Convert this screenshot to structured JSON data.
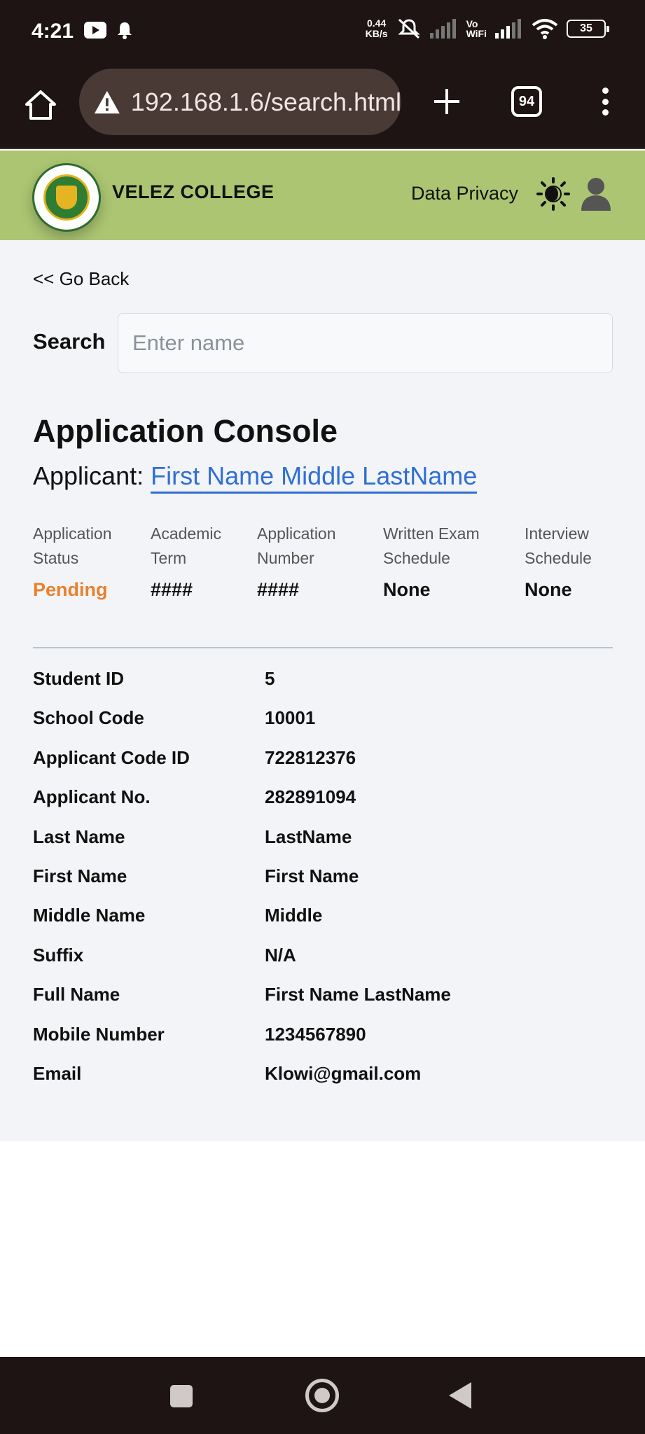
{
  "status_bar": {
    "time": "4:21",
    "net_speed_value": "0.44",
    "net_speed_unit": "KB/s",
    "vowifi_top": "Vo",
    "vowifi_bottom": "WiFi",
    "battery": "35"
  },
  "browser": {
    "url": "192.168.1.6/search.html",
    "tab_count": "94"
  },
  "header": {
    "brand": "VELEZ COLLEGE",
    "privacy_link": "Data Privacy"
  },
  "page": {
    "go_back": "<< Go Back",
    "search_label": "Search",
    "search_placeholder": "Enter name",
    "console_title": "Application Console",
    "applicant_prefix": "Applicant: ",
    "applicant_name": "First Name Middle LastName"
  },
  "summary": {
    "status_head_1": "Application",
    "status_head_2": "Status",
    "status_value": "Pending",
    "term_head_1": "Academic",
    "term_head_2": "Term",
    "term_value": "####",
    "number_head_1": "Application",
    "number_head_2": "Number",
    "number_value": "####",
    "exam_head_1": "Written Exam",
    "exam_head_2": "Schedule",
    "exam_value": "None",
    "interview_head_1": "Interview",
    "interview_head_2": "Schedule",
    "interview_value": "None",
    "status_color": "#e8802c"
  },
  "details": [
    {
      "label": "Student ID",
      "value": "5"
    },
    {
      "label": "School Code",
      "value": "10001"
    },
    {
      "label": "Applicant Code ID",
      "value": "722812376"
    },
    {
      "label": "Applicant No.",
      "value": "282891094"
    },
    {
      "label": "Last Name",
      "value": "LastName"
    },
    {
      "label": "First Name",
      "value": "First Name"
    },
    {
      "label": "Middle Name",
      "value": "Middle"
    },
    {
      "label": "Suffix",
      "value": "N/A"
    },
    {
      "label": "Full Name",
      "value": "First Name LastName"
    },
    {
      "label": "Mobile Number",
      "value": "1234567890"
    },
    {
      "label": "Email",
      "value": "Klowi@gmail.com"
    }
  ],
  "colors": {
    "header_bg": "#abc572",
    "link": "#2f6fd6",
    "chrome_bg": "#1e1414"
  }
}
